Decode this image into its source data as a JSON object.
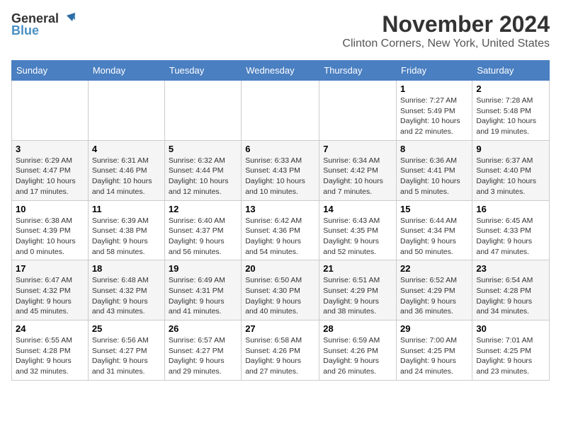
{
  "logo": {
    "line1": "General",
    "line2": "Blue"
  },
  "title": "November 2024",
  "location": "Clinton Corners, New York, United States",
  "days_of_week": [
    "Sunday",
    "Monday",
    "Tuesday",
    "Wednesday",
    "Thursday",
    "Friday",
    "Saturday"
  ],
  "weeks": [
    [
      {
        "day": "",
        "info": ""
      },
      {
        "day": "",
        "info": ""
      },
      {
        "day": "",
        "info": ""
      },
      {
        "day": "",
        "info": ""
      },
      {
        "day": "",
        "info": ""
      },
      {
        "day": "1",
        "info": "Sunrise: 7:27 AM\nSunset: 5:49 PM\nDaylight: 10 hours and 22 minutes."
      },
      {
        "day": "2",
        "info": "Sunrise: 7:28 AM\nSunset: 5:48 PM\nDaylight: 10 hours and 19 minutes."
      }
    ],
    [
      {
        "day": "3",
        "info": "Sunrise: 6:29 AM\nSunset: 4:47 PM\nDaylight: 10 hours and 17 minutes."
      },
      {
        "day": "4",
        "info": "Sunrise: 6:31 AM\nSunset: 4:46 PM\nDaylight: 10 hours and 14 minutes."
      },
      {
        "day": "5",
        "info": "Sunrise: 6:32 AM\nSunset: 4:44 PM\nDaylight: 10 hours and 12 minutes."
      },
      {
        "day": "6",
        "info": "Sunrise: 6:33 AM\nSunset: 4:43 PM\nDaylight: 10 hours and 10 minutes."
      },
      {
        "day": "7",
        "info": "Sunrise: 6:34 AM\nSunset: 4:42 PM\nDaylight: 10 hours and 7 minutes."
      },
      {
        "day": "8",
        "info": "Sunrise: 6:36 AM\nSunset: 4:41 PM\nDaylight: 10 hours and 5 minutes."
      },
      {
        "day": "9",
        "info": "Sunrise: 6:37 AM\nSunset: 4:40 PM\nDaylight: 10 hours and 3 minutes."
      }
    ],
    [
      {
        "day": "10",
        "info": "Sunrise: 6:38 AM\nSunset: 4:39 PM\nDaylight: 10 hours and 0 minutes."
      },
      {
        "day": "11",
        "info": "Sunrise: 6:39 AM\nSunset: 4:38 PM\nDaylight: 9 hours and 58 minutes."
      },
      {
        "day": "12",
        "info": "Sunrise: 6:40 AM\nSunset: 4:37 PM\nDaylight: 9 hours and 56 minutes."
      },
      {
        "day": "13",
        "info": "Sunrise: 6:42 AM\nSunset: 4:36 PM\nDaylight: 9 hours and 54 minutes."
      },
      {
        "day": "14",
        "info": "Sunrise: 6:43 AM\nSunset: 4:35 PM\nDaylight: 9 hours and 52 minutes."
      },
      {
        "day": "15",
        "info": "Sunrise: 6:44 AM\nSunset: 4:34 PM\nDaylight: 9 hours and 50 minutes."
      },
      {
        "day": "16",
        "info": "Sunrise: 6:45 AM\nSunset: 4:33 PM\nDaylight: 9 hours and 47 minutes."
      }
    ],
    [
      {
        "day": "17",
        "info": "Sunrise: 6:47 AM\nSunset: 4:32 PM\nDaylight: 9 hours and 45 minutes."
      },
      {
        "day": "18",
        "info": "Sunrise: 6:48 AM\nSunset: 4:32 PM\nDaylight: 9 hours and 43 minutes."
      },
      {
        "day": "19",
        "info": "Sunrise: 6:49 AM\nSunset: 4:31 PM\nDaylight: 9 hours and 41 minutes."
      },
      {
        "day": "20",
        "info": "Sunrise: 6:50 AM\nSunset: 4:30 PM\nDaylight: 9 hours and 40 minutes."
      },
      {
        "day": "21",
        "info": "Sunrise: 6:51 AM\nSunset: 4:29 PM\nDaylight: 9 hours and 38 minutes."
      },
      {
        "day": "22",
        "info": "Sunrise: 6:52 AM\nSunset: 4:29 PM\nDaylight: 9 hours and 36 minutes."
      },
      {
        "day": "23",
        "info": "Sunrise: 6:54 AM\nSunset: 4:28 PM\nDaylight: 9 hours and 34 minutes."
      }
    ],
    [
      {
        "day": "24",
        "info": "Sunrise: 6:55 AM\nSunset: 4:28 PM\nDaylight: 9 hours and 32 minutes."
      },
      {
        "day": "25",
        "info": "Sunrise: 6:56 AM\nSunset: 4:27 PM\nDaylight: 9 hours and 31 minutes."
      },
      {
        "day": "26",
        "info": "Sunrise: 6:57 AM\nSunset: 4:27 PM\nDaylight: 9 hours and 29 minutes."
      },
      {
        "day": "27",
        "info": "Sunrise: 6:58 AM\nSunset: 4:26 PM\nDaylight: 9 hours and 27 minutes."
      },
      {
        "day": "28",
        "info": "Sunrise: 6:59 AM\nSunset: 4:26 PM\nDaylight: 9 hours and 26 minutes."
      },
      {
        "day": "29",
        "info": "Sunrise: 7:00 AM\nSunset: 4:25 PM\nDaylight: 9 hours and 24 minutes."
      },
      {
        "day": "30",
        "info": "Sunrise: 7:01 AM\nSunset: 4:25 PM\nDaylight: 9 hours and 23 minutes."
      }
    ]
  ]
}
